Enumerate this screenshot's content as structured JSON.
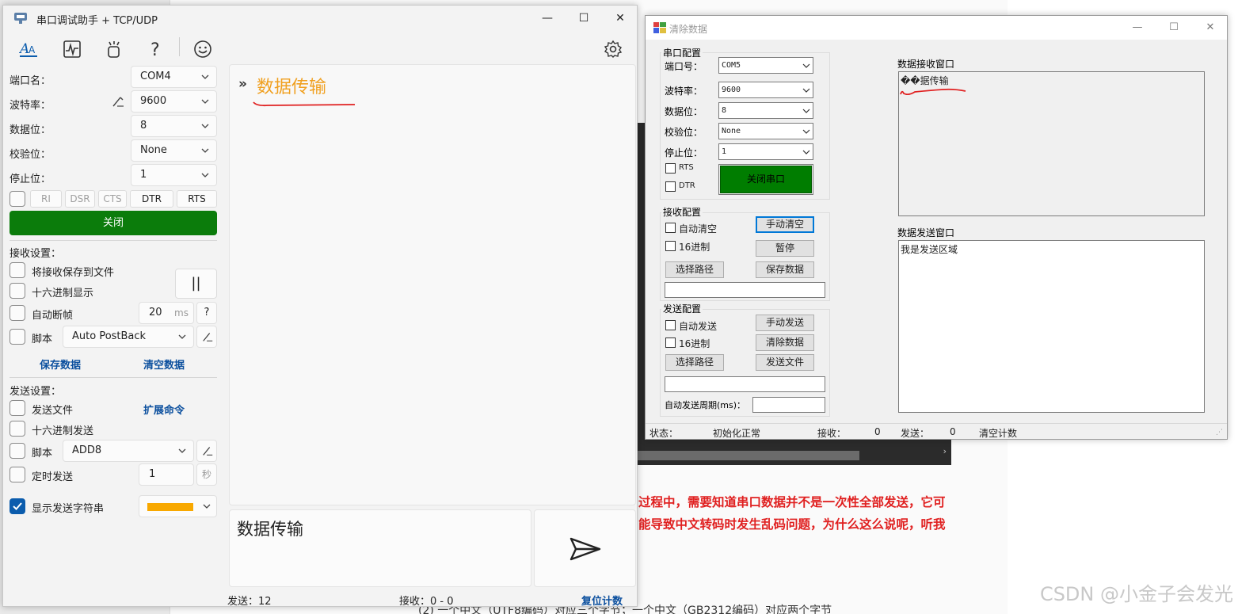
{
  "main_window": {
    "title": "串口调试助手 + TCP/UDP",
    "labels": {
      "port": "端口名：",
      "baud": "波特率：",
      "databits": "数据位：",
      "parity": "校验位：",
      "stopbits": "停止位："
    },
    "values": {
      "port": "COM4",
      "baud": "9600",
      "databits": "8",
      "parity": "None",
      "stopbits": "1"
    },
    "signals": [
      "RI",
      "DSR",
      "CTS",
      "DTR",
      "RTS"
    ],
    "close_button": "关闭",
    "recv_settings": {
      "title": "接收设置：",
      "save_to_file": "将接收保存到文件",
      "hex_display": "十六进制显示",
      "auto_frame": "自动断帧",
      "frame_ms": "20",
      "ms_unit": "ms",
      "help": "?",
      "script": "脚本",
      "script_value": "Auto PostBack",
      "pause": "||",
      "save_data": "保存数据",
      "clear_data": "清空数据"
    },
    "send_settings": {
      "title": "发送设置：",
      "send_file": "发送文件",
      "ext_cmd": "扩展命令",
      "hex_send": "十六进制发送",
      "script": "脚本",
      "script_value": "ADD8",
      "timed_send": "定时发送",
      "timed_value": "1",
      "sec_unit": "秒",
      "show_send": "显示发送字符串"
    },
    "receive_arrow": "»",
    "receive_text": "数据传输",
    "send_text": "数据传输",
    "status": {
      "sent": "发送：12",
      "received": "接收：0 - 0",
      "reset": "复位计数"
    },
    "colors": {
      "accent_green": "#0b7c0b",
      "receive_text": "#f0a020",
      "checkbox_checked": "#0b5cad",
      "show_color": "#f8a800"
    }
  },
  "second_window": {
    "title": "清除数据",
    "serial_group": {
      "title": "串口配置",
      "port_label": "端口号：",
      "port_value": "COM5",
      "baud_label": "波特率：",
      "baud_value": "9600",
      "databits_label": "数据位：",
      "databits_value": "8",
      "parity_label": "校验位：",
      "parity_value": "None",
      "stopbits_label": "停止位：",
      "stopbits_value": "1",
      "rts": "RTS",
      "dtr": "DTR",
      "toggle": "关闭串口"
    },
    "recv_group": {
      "title": "接收配置",
      "auto_clear": "自动清空",
      "manual_clear": "手动清空",
      "hex": "16进制",
      "pause": "暂停",
      "choose_path": "选择路径",
      "save_data": "保存数据"
    },
    "send_group": {
      "title": "发送配置",
      "auto_send": "自动发送",
      "manual_send": "手动发送",
      "hex": "16进制",
      "clear_data": "清除数据",
      "choose_path": "选择路径",
      "send_file": "发送文件",
      "period": "自动发送周期(ms)："
    },
    "recv_window_label": "数据接收窗口",
    "recv_window_text": "��据传输",
    "send_window_label": "数据发送窗口",
    "send_window_text": "我是发送区域",
    "status": {
      "state_label": "状态：",
      "state_value": "初始化正常",
      "recv_label": "接收：",
      "recv_value": "0",
      "send_label": "发送：",
      "send_value": "0",
      "clear_count": "清空计数"
    }
  },
  "background": {
    "red_line_1": "过程中，需要知道串口数据并不是一次性全部发送，它可",
    "red_line_2": "能导致中文转码时发生乱码问题，为什么这么说呢，听我",
    "footer_line": "(2) 一个中文（UTF8编码）对应三个字节；一个中文（GB2312编码）对应两个字节",
    "watermark": "CSDN @小金子会发光"
  }
}
